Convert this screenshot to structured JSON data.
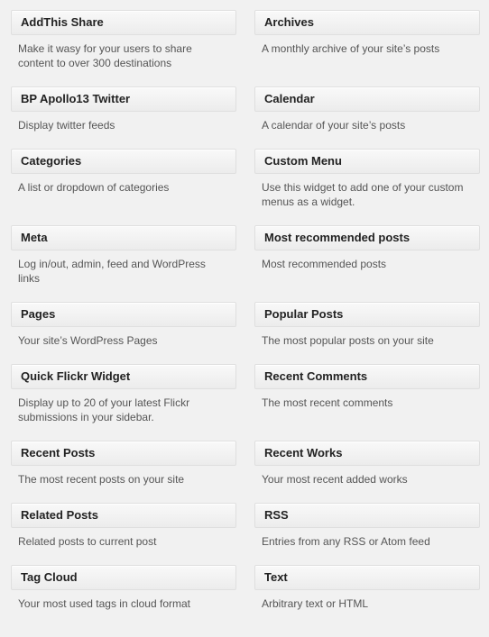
{
  "widgets": [
    {
      "title": "AddThis Share",
      "description": "Make it wasy for your users to share content to over 300 destinations"
    },
    {
      "title": "Archives",
      "description": "A monthly archive of your site’s posts"
    },
    {
      "title": "BP Apollo13 Twitter",
      "description": "Display twitter feeds"
    },
    {
      "title": "Calendar",
      "description": "A calendar of your site’s posts"
    },
    {
      "title": "Categories",
      "description": "A list or dropdown of categories"
    },
    {
      "title": "Custom Menu",
      "description": "Use this widget to add one of your custom menus as a widget."
    },
    {
      "title": "Meta",
      "description": "Log in/out, admin, feed and WordPress links"
    },
    {
      "title": "Most recommended posts",
      "description": "Most recommended posts"
    },
    {
      "title": "Pages",
      "description": "Your site’s WordPress Pages"
    },
    {
      "title": "Popular Posts",
      "description": "The most popular posts on your site"
    },
    {
      "title": "Quick Flickr Widget",
      "description": "Display up to 20 of your latest Flickr submissions in your sidebar."
    },
    {
      "title": "Recent Comments",
      "description": "The most recent comments"
    },
    {
      "title": "Recent Posts",
      "description": "The most recent posts on your site"
    },
    {
      "title": "Recent Works",
      "description": "Your most recent added works"
    },
    {
      "title": "Related Posts",
      "description": "Related posts to current post"
    },
    {
      "title": "RSS",
      "description": "Entries from any RSS or Atom feed"
    },
    {
      "title": "Tag Cloud",
      "description": "Your most used tags in cloud format"
    },
    {
      "title": "Text",
      "description": "Arbitrary text or HTML"
    }
  ]
}
